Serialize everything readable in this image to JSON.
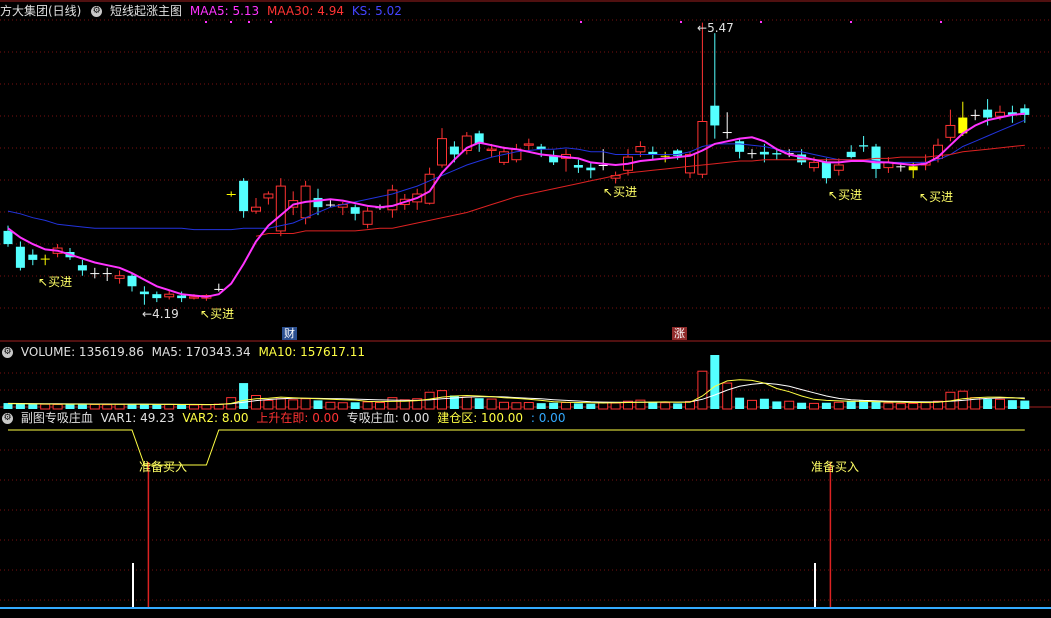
{
  "main_panel": {
    "stock_name": "方大集团(日线)",
    "indicator_name": "短线起涨主图",
    "legend": [
      {
        "label": "MAA5: 5.13",
        "color": "#ff33ff"
      },
      {
        "label": "MAA30: 4.94",
        "color": "#ff3333"
      },
      {
        "label": "KS: 5.02",
        "color": "#3333ff"
      }
    ],
    "high_label": "5.47",
    "low_label": "4.19",
    "buy_label": "买进",
    "event_tags": [
      {
        "label": "财",
        "color": "#3a5fa0"
      },
      {
        "label": "涨",
        "color": "#a03030"
      }
    ]
  },
  "volume_panel": {
    "title": "VOLUME: 135619.86",
    "ma5": "MA5: 170343.34",
    "ma10": "MA10: 157617.11"
  },
  "sub_panel": {
    "title": "副图专吸庄血",
    "var1": "VAR1: 49.23",
    "var2": "VAR2: 8.00",
    "rising": "上升在即: 0.00",
    "zhuanxi": "专吸庄血: 0.00",
    "jiancang": "建仓区: 100.00",
    "extra": ": 0.00",
    "prepare_label": "准备买入"
  },
  "chart_data": {
    "type": "candlestick",
    "candles": [
      [
        5.0,
        4.9,
        5.04,
        4.88
      ],
      [
        4.88,
        4.72,
        4.92,
        4.7
      ],
      [
        4.82,
        4.78,
        4.86,
        4.74
      ],
      [
        4.79,
        4.79,
        4.82,
        4.74
      ],
      [
        4.83,
        4.87,
        4.9,
        4.8
      ],
      [
        4.84,
        4.8,
        4.87,
        4.78
      ],
      [
        4.74,
        4.7,
        4.78,
        4.66
      ],
      [
        4.68,
        4.68,
        4.72,
        4.64
      ],
      [
        4.68,
        4.68,
        4.72,
        4.62
      ],
      [
        4.64,
        4.66,
        4.7,
        4.6
      ],
      [
        4.66,
        4.58,
        4.68,
        4.54
      ],
      [
        4.54,
        4.52,
        4.58,
        4.44
      ],
      [
        4.52,
        4.49,
        4.54,
        4.46
      ],
      [
        4.5,
        4.52,
        4.55,
        4.48
      ],
      [
        4.51,
        4.49,
        4.54,
        4.46
      ],
      [
        4.49,
        4.5,
        4.52,
        4.48
      ],
      [
        4.49,
        4.51,
        4.52,
        4.47
      ],
      [
        4.56,
        4.56,
        4.6,
        4.54
      ],
      [
        5.28,
        5.28,
        5.3,
        5.26
      ],
      [
        5.38,
        5.15,
        5.4,
        5.1
      ],
      [
        5.15,
        5.18,
        5.25,
        5.13
      ],
      [
        5.25,
        5.28,
        5.3,
        5.2
      ],
      [
        5.0,
        5.34,
        5.4,
        4.96
      ],
      [
        5.18,
        5.23,
        5.3,
        5.12
      ],
      [
        5.1,
        5.34,
        5.38,
        5.05
      ],
      [
        5.25,
        5.18,
        5.32,
        5.12
      ],
      [
        5.2,
        5.2,
        5.24,
        5.18
      ],
      [
        5.18,
        5.2,
        5.22,
        5.12
      ],
      [
        5.18,
        5.13,
        5.2,
        5.08
      ],
      [
        5.05,
        5.15,
        5.18,
        5.02
      ],
      [
        5.18,
        5.18,
        5.2,
        5.16
      ],
      [
        5.16,
        5.31,
        5.35,
        5.1
      ],
      [
        5.2,
        5.24,
        5.28,
        5.16
      ],
      [
        5.22,
        5.28,
        5.32,
        5.16
      ],
      [
        5.21,
        5.43,
        5.48,
        5.2
      ],
      [
        5.5,
        5.7,
        5.78,
        5.48
      ],
      [
        5.64,
        5.58,
        5.68,
        5.52
      ],
      [
        5.61,
        5.72,
        5.75,
        5.58
      ],
      [
        5.74,
        5.66,
        5.76,
        5.6
      ],
      [
        5.61,
        5.62,
        5.66,
        5.56
      ],
      [
        5.52,
        5.6,
        5.64,
        5.5
      ],
      [
        5.54,
        5.62,
        5.66,
        5.52
      ],
      [
        5.65,
        5.66,
        5.7,
        5.6
      ],
      [
        5.64,
        5.62,
        5.66,
        5.56
      ],
      [
        5.57,
        5.52,
        5.61,
        5.5
      ],
      [
        5.55,
        5.58,
        5.62,
        5.45
      ],
      [
        5.5,
        5.48,
        5.54,
        5.44
      ],
      [
        5.48,
        5.46,
        5.52,
        5.4
      ],
      [
        5.5,
        5.5,
        5.62,
        5.46
      ],
      [
        5.4,
        5.42,
        5.45,
        5.36
      ],
      [
        5.46,
        5.56,
        5.62,
        5.42
      ],
      [
        5.6,
        5.64,
        5.68,
        5.56
      ],
      [
        5.6,
        5.58,
        5.64,
        5.54
      ],
      [
        5.57,
        5.57,
        5.6,
        5.52
      ],
      [
        5.61,
        5.57,
        5.62,
        5.54
      ],
      [
        5.44,
        5.58,
        5.6,
        5.4
      ],
      [
        5.43,
        5.83,
        6.58,
        5.4
      ],
      [
        5.95,
        5.8,
        6.5,
        5.7
      ],
      [
        5.75,
        5.75,
        5.9,
        5.7
      ],
      [
        5.68,
        5.6,
        5.7,
        5.55
      ],
      [
        5.59,
        5.59,
        5.62,
        5.55
      ],
      [
        5.6,
        5.58,
        5.66,
        5.52
      ],
      [
        5.59,
        5.58,
        5.62,
        5.54
      ],
      [
        5.59,
        5.59,
        5.62,
        5.56
      ],
      [
        5.58,
        5.52,
        5.62,
        5.5
      ],
      [
        5.48,
        5.52,
        5.56,
        5.45
      ],
      [
        5.52,
        5.4,
        5.55,
        5.36
      ],
      [
        5.46,
        5.5,
        5.55,
        5.42
      ],
      [
        5.6,
        5.56,
        5.65,
        5.55
      ],
      [
        5.65,
        5.64,
        5.72,
        5.6
      ],
      [
        5.64,
        5.47,
        5.66,
        5.4
      ],
      [
        5.48,
        5.52,
        5.56,
        5.44
      ],
      [
        5.49,
        5.49,
        5.52,
        5.45
      ],
      [
        5.46,
        5.49,
        5.52,
        5.4
      ],
      [
        5.5,
        5.52,
        5.58,
        5.46
      ],
      [
        5.55,
        5.65,
        5.7,
        5.52
      ],
      [
        5.71,
        5.8,
        5.92,
        5.68
      ],
      [
        5.74,
        5.86,
        5.98,
        5.72
      ],
      [
        5.88,
        5.88,
        5.92,
        5.84
      ],
      [
        5.92,
        5.86,
        6.0,
        5.8
      ],
      [
        5.87,
        5.9,
        5.95,
        5.84
      ],
      [
        5.9,
        5.88,
        5.95,
        5.82
      ],
      [
        5.93,
        5.88,
        5.96,
        5.82
      ]
    ],
    "volumes": [
      0.55,
      0.48,
      0.46,
      0.44,
      0.42,
      0.45,
      0.5,
      0.42,
      0.4,
      0.44,
      0.46,
      0.45,
      0.4,
      0.42,
      0.4,
      0.38,
      0.4,
      0.45,
      1.05,
      2.4,
      1.25,
      0.8,
      0.95,
      0.85,
      0.95,
      0.8,
      0.62,
      0.58,
      0.62,
      0.65,
      0.6,
      1.05,
      0.85,
      0.95,
      1.55,
      1.7,
      1.25,
      1.1,
      1.0,
      0.92,
      0.62,
      0.58,
      0.6,
      0.54,
      0.58,
      0.6,
      0.52,
      0.48,
      0.62,
      0.55,
      0.72,
      0.82,
      0.66,
      0.58,
      0.52,
      0.7,
      3.5,
      5.0,
      2.4,
      1.05,
      0.8,
      0.95,
      0.7,
      0.72,
      0.58,
      0.52,
      0.58,
      0.62,
      0.75,
      0.82,
      0.72,
      0.55,
      0.5,
      0.52,
      0.58,
      0.72,
      1.55,
      1.65,
      1.05,
      0.92,
      0.9,
      0.82,
      0.78
    ],
    "pink_line": [
      5.02,
      4.95,
      4.9,
      4.86,
      4.85,
      4.82,
      4.79,
      4.76,
      4.74,
      4.72,
      4.68,
      4.63,
      4.58,
      4.55,
      4.52,
      4.51,
      4.5,
      4.52,
      4.6,
      4.75,
      4.92,
      5.04,
      5.12,
      5.2,
      5.22,
      5.23,
      5.24,
      5.23,
      5.21,
      5.19,
      5.18,
      5.19,
      5.22,
      5.25,
      5.3,
      5.44,
      5.54,
      5.63,
      5.67,
      5.65,
      5.63,
      5.62,
      5.6,
      5.58,
      5.57,
      5.56,
      5.55,
      5.52,
      5.51,
      5.5,
      5.51,
      5.53,
      5.54,
      5.55,
      5.56,
      5.57,
      5.61,
      5.66,
      5.68,
      5.7,
      5.71,
      5.68,
      5.62,
      5.58,
      5.56,
      5.54,
      5.52,
      5.52,
      5.53,
      5.53,
      5.52,
      5.52,
      5.51,
      5.5,
      5.51,
      5.56,
      5.65,
      5.74,
      5.8,
      5.84,
      5.86,
      5.88,
      5.89
    ],
    "red_line": [
      null,
      null,
      null,
      null,
      null,
      null,
      null,
      null,
      null,
      null,
      null,
      null,
      null,
      null,
      null,
      null,
      null,
      null,
      null,
      null,
      4.96,
      4.98,
      4.98,
      4.98,
      5.0,
      5.0,
      5.0,
      5.0,
      5.0,
      5.01,
      5.02,
      5.02,
      5.04,
      5.06,
      5.08,
      5.1,
      5.12,
      5.14,
      5.17,
      5.2,
      5.23,
      5.26,
      5.28,
      5.3,
      5.32,
      5.34,
      5.36,
      5.38,
      5.4,
      5.42,
      5.44,
      5.45,
      5.46,
      5.47,
      5.48,
      5.49,
      5.5,
      5.51,
      5.52,
      5.53,
      5.53,
      5.54,
      5.54,
      5.54,
      5.54,
      5.54,
      5.54,
      5.54,
      5.54,
      5.54,
      5.55,
      5.55,
      5.56,
      5.56,
      5.56,
      5.57,
      5.58,
      5.6,
      5.61,
      5.62,
      5.63,
      5.64,
      5.65
    ],
    "blue_line": [
      5.15,
      5.13,
      5.1,
      5.08,
      5.05,
      5.04,
      5.03,
      5.02,
      5.02,
      5.02,
      5.02,
      5.02,
      5.02,
      5.02,
      5.02,
      5.01,
      5.01,
      5.01,
      5.01,
      5.02,
      5.02,
      5.02,
      5.04,
      5.06,
      5.1,
      5.14,
      5.18,
      5.2,
      5.22,
      5.24,
      5.26,
      5.28,
      5.31,
      5.34,
      5.38,
      5.42,
      5.46,
      5.5,
      5.53,
      5.56,
      5.58,
      5.6,
      5.61,
      5.62,
      5.62,
      5.63,
      5.62,
      5.6,
      5.6,
      5.58,
      5.58,
      5.58,
      5.58,
      5.58,
      5.58,
      5.6,
      5.64,
      5.66,
      5.66,
      5.66,
      5.65,
      5.64,
      5.62,
      5.6,
      5.6,
      5.58,
      5.56,
      5.54,
      5.54,
      5.54,
      5.53,
      5.52,
      5.52,
      5.52,
      5.52,
      5.54,
      5.58,
      5.64,
      5.68,
      5.72,
      5.76,
      5.8,
      5.84
    ],
    "volume_ma_yellow": [
      0.5,
      0.48,
      0.47,
      0.46,
      0.45,
      0.45,
      0.45,
      0.44,
      0.44,
      0.44,
      0.44,
      0.44,
      0.43,
      0.43,
      0.42,
      0.42,
      0.41,
      0.42,
      0.52,
      0.8,
      0.95,
      1.0,
      1.1,
      1.05,
      1.0,
      0.95,
      0.9,
      0.85,
      0.82,
      0.7,
      0.68,
      0.7,
      0.72,
      0.78,
      0.92,
      1.1,
      1.2,
      1.25,
      1.2,
      1.15,
      1.05,
      0.98,
      0.9,
      0.8,
      0.68,
      0.62,
      0.6,
      0.58,
      0.56,
      0.58,
      0.6,
      0.62,
      0.64,
      0.66,
      0.62,
      0.62,
      1.2,
      2.1,
      2.6,
      2.7,
      2.65,
      2.4,
      1.9,
      1.6,
      1.2,
      0.9,
      0.8,
      0.75,
      0.72,
      0.7,
      0.68,
      0.65,
      0.62,
      0.6,
      0.6,
      0.62,
      0.75,
      0.95,
      1.05,
      1.1,
      1.1,
      1.05,
      0.95
    ],
    "volume_ma_white": [
      0.52,
      0.51,
      0.5,
      0.49,
      0.48,
      0.47,
      0.47,
      0.46,
      0.46,
      0.45,
      0.45,
      0.45,
      0.44,
      0.44,
      0.43,
      0.43,
      0.42,
      0.43,
      0.48,
      0.62,
      0.78,
      0.88,
      0.95,
      1.0,
      1.0,
      0.98,
      0.96,
      0.94,
      0.92,
      0.88,
      0.84,
      0.82,
      0.8,
      0.8,
      0.84,
      0.94,
      1.02,
      1.1,
      1.14,
      1.15,
      1.12,
      1.06,
      1.0,
      0.94,
      0.86,
      0.8,
      0.74,
      0.68,
      0.64,
      0.62,
      0.62,
      0.62,
      0.63,
      0.64,
      0.64,
      0.66,
      0.9,
      1.3,
      1.75,
      2.1,
      2.3,
      2.4,
      2.3,
      2.1,
      1.8,
      1.5,
      1.2,
      0.98,
      0.86,
      0.8,
      0.76,
      0.72,
      0.7,
      0.68,
      0.66,
      0.66,
      0.72,
      0.8,
      0.9,
      0.98,
      1.02,
      1.04,
      1.02
    ],
    "sub_yellow_line": [
      100,
      100,
      100,
      100,
      100,
      100,
      100,
      100,
      100,
      100,
      100,
      80,
      80,
      80,
      80,
      80,
      80,
      100,
      100,
      100,
      100,
      100,
      100,
      100,
      100,
      100,
      100,
      100,
      100,
      100,
      100,
      100,
      100,
      100,
      100,
      100,
      100,
      100,
      100,
      100,
      100,
      100,
      100,
      100,
      100,
      100,
      100,
      100,
      100,
      100,
      100,
      100,
      100,
      100,
      100,
      100,
      100,
      100,
      100,
      100,
      100,
      100,
      100,
      100,
      100,
      100,
      100,
      100,
      100,
      100,
      100,
      100,
      100,
      100,
      100,
      100,
      100,
      100,
      100,
      100,
      100,
      100,
      100
    ],
    "buy_marker_indices": [
      3,
      18,
      53,
      73,
      77
    ],
    "prepare_marker_indices": [
      11,
      66
    ],
    "white_spike_indices": [
      10,
      65
    ]
  }
}
